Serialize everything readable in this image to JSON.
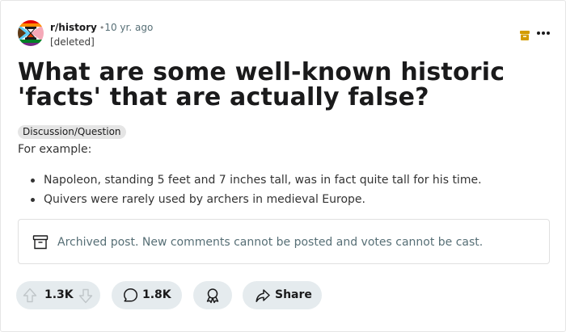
{
  "post": {
    "subreddit": "r/history",
    "separator": "•",
    "age": "10 yr. ago",
    "author": "[deleted]",
    "title": "What are some well-known historic 'facts' that are actually false?",
    "flair": "Discussion/Question",
    "body_intro": "For example:",
    "bullets": [
      "Napoleon, standing 5 feet and 7 inches tall, was in fact quite tall for his time.",
      "Quivers were rarely used by archers in medieval Europe."
    ],
    "archived_notice": "Archived post. New comments cannot be posted and votes cannot be cast."
  },
  "actions": {
    "vote_count": "1.3K",
    "comment_count": "1.8K",
    "share_label": "Share"
  },
  "icons": {
    "subreddit_avatar": "hourglass-pride-avatar",
    "archive_badge": "archive-box-icon",
    "more": "ellipsis-icon",
    "archived": "archive-box-icon",
    "upvote": "arrow-up-icon",
    "downvote": "arrow-down-icon",
    "comment": "speech-bubble-icon",
    "award": "award-ribbon-icon",
    "share": "share-arrow-icon"
  },
  "colors": {
    "archive_badge": "#d39c00",
    "pill_bg": "#e5ebee",
    "muted_text": "#576f76"
  }
}
